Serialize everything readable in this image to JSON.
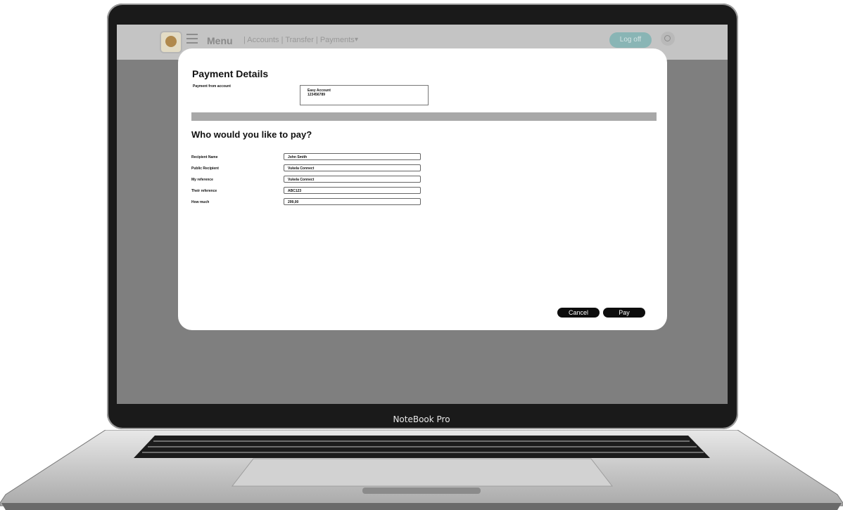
{
  "laptop": {
    "brand": "NoteBook Pro"
  },
  "topbar": {
    "menu_label": "Menu",
    "nav_links": "| Accounts | Transfer | Payments",
    "caret": "▾",
    "logout_label": "Log off"
  },
  "payment": {
    "title": "Payment Details",
    "from_label": "Payment from account",
    "account_name": "Easy Account",
    "account_number": "123456789"
  },
  "recipient": {
    "heading": "Who would you like to pay?",
    "rows": [
      {
        "label": "Recipient Name",
        "value": "John Smith"
      },
      {
        "label": "Public Recipient",
        "value": "Vukela Connect"
      },
      {
        "label": "My reference",
        "value": "Vukela Connect"
      },
      {
        "label": "Their reference",
        "value": "ABC123"
      },
      {
        "label": "How much",
        "value": "299,00"
      }
    ]
  },
  "actions": {
    "cancel_label": "Cancel",
    "pay_label": "Pay"
  },
  "colors": {
    "screen_bg": "#7f7f7f",
    "button_bg": "#0d0d0d",
    "divider": "#a8a8a8"
  }
}
